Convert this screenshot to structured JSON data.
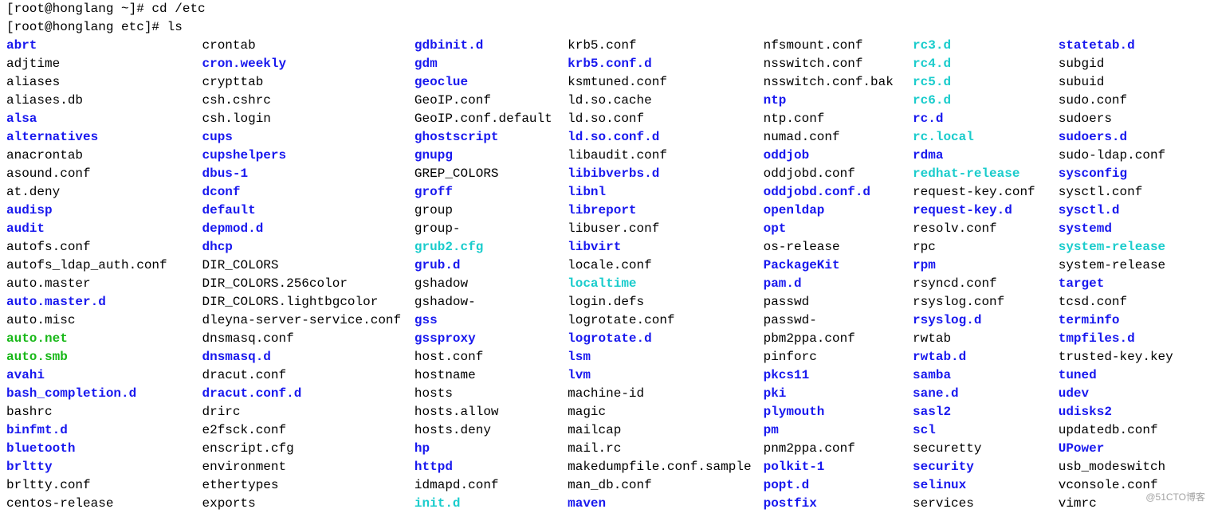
{
  "prompt1": "[root@honglang ~]# cd /etc",
  "prompt2": "[root@honglang etc]# ls",
  "watermark": "@51CTO博客",
  "columns": [
    [
      {
        "name": "abrt",
        "type": "dir"
      },
      {
        "name": "adjtime",
        "type": "file"
      },
      {
        "name": "aliases",
        "type": "file"
      },
      {
        "name": "aliases.db",
        "type": "file"
      },
      {
        "name": "alsa",
        "type": "dir"
      },
      {
        "name": "alternatives",
        "type": "dir"
      },
      {
        "name": "anacrontab",
        "type": "file"
      },
      {
        "name": "asound.conf",
        "type": "file"
      },
      {
        "name": "at.deny",
        "type": "file"
      },
      {
        "name": "audisp",
        "type": "dir"
      },
      {
        "name": "audit",
        "type": "dir"
      },
      {
        "name": "autofs.conf",
        "type": "file"
      },
      {
        "name": "autofs_ldap_auth.conf",
        "type": "file"
      },
      {
        "name": "auto.master",
        "type": "file"
      },
      {
        "name": "auto.master.d",
        "type": "dir"
      },
      {
        "name": "auto.misc",
        "type": "file"
      },
      {
        "name": "auto.net",
        "type": "exec"
      },
      {
        "name": "auto.smb",
        "type": "exec"
      },
      {
        "name": "avahi",
        "type": "dir"
      },
      {
        "name": "bash_completion.d",
        "type": "dir"
      },
      {
        "name": "bashrc",
        "type": "file"
      },
      {
        "name": "binfmt.d",
        "type": "dir"
      },
      {
        "name": "bluetooth",
        "type": "dir"
      },
      {
        "name": "brltty",
        "type": "dir"
      },
      {
        "name": "brltty.conf",
        "type": "file"
      },
      {
        "name": "centos-release",
        "type": "file"
      }
    ],
    [
      {
        "name": "crontab",
        "type": "file"
      },
      {
        "name": "cron.weekly",
        "type": "dir"
      },
      {
        "name": "crypttab",
        "type": "file"
      },
      {
        "name": "csh.cshrc",
        "type": "file"
      },
      {
        "name": "csh.login",
        "type": "file"
      },
      {
        "name": "cups",
        "type": "dir"
      },
      {
        "name": "cupshelpers",
        "type": "dir"
      },
      {
        "name": "dbus-1",
        "type": "dir"
      },
      {
        "name": "dconf",
        "type": "dir"
      },
      {
        "name": "default",
        "type": "dir"
      },
      {
        "name": "depmod.d",
        "type": "dir"
      },
      {
        "name": "dhcp",
        "type": "dir"
      },
      {
        "name": "DIR_COLORS",
        "type": "file"
      },
      {
        "name": "DIR_COLORS.256color",
        "type": "file"
      },
      {
        "name": "DIR_COLORS.lightbgcolor",
        "type": "file"
      },
      {
        "name": "dleyna-server-service.conf",
        "type": "file"
      },
      {
        "name": "dnsmasq.conf",
        "type": "file"
      },
      {
        "name": "dnsmasq.d",
        "type": "dir"
      },
      {
        "name": "dracut.conf",
        "type": "file"
      },
      {
        "name": "dracut.conf.d",
        "type": "dir"
      },
      {
        "name": "drirc",
        "type": "file"
      },
      {
        "name": "e2fsck.conf",
        "type": "file"
      },
      {
        "name": "enscript.cfg",
        "type": "file"
      },
      {
        "name": "environment",
        "type": "file"
      },
      {
        "name": "ethertypes",
        "type": "file"
      },
      {
        "name": "exports",
        "type": "file"
      }
    ],
    [
      {
        "name": "gdbinit.d",
        "type": "dir"
      },
      {
        "name": "gdm",
        "type": "dir"
      },
      {
        "name": "geoclue",
        "type": "dir"
      },
      {
        "name": "GeoIP.conf",
        "type": "file"
      },
      {
        "name": "GeoIP.conf.default",
        "type": "file"
      },
      {
        "name": "ghostscript",
        "type": "dir"
      },
      {
        "name": "gnupg",
        "type": "dir"
      },
      {
        "name": "GREP_COLORS",
        "type": "file"
      },
      {
        "name": "groff",
        "type": "dir"
      },
      {
        "name": "group",
        "type": "file"
      },
      {
        "name": "group-",
        "type": "file"
      },
      {
        "name": "grub2.cfg",
        "type": "link"
      },
      {
        "name": "grub.d",
        "type": "dir"
      },
      {
        "name": "gshadow",
        "type": "file"
      },
      {
        "name": "gshadow-",
        "type": "file"
      },
      {
        "name": "gss",
        "type": "dir"
      },
      {
        "name": "gssproxy",
        "type": "dir"
      },
      {
        "name": "host.conf",
        "type": "file"
      },
      {
        "name": "hostname",
        "type": "file"
      },
      {
        "name": "hosts",
        "type": "file"
      },
      {
        "name": "hosts.allow",
        "type": "file"
      },
      {
        "name": "hosts.deny",
        "type": "file"
      },
      {
        "name": "hp",
        "type": "dir"
      },
      {
        "name": "httpd",
        "type": "dir"
      },
      {
        "name": "idmapd.conf",
        "type": "file"
      },
      {
        "name": "init.d",
        "type": "link"
      }
    ],
    [
      {
        "name": "krb5.conf",
        "type": "file"
      },
      {
        "name": "krb5.conf.d",
        "type": "dir"
      },
      {
        "name": "ksmtuned.conf",
        "type": "file"
      },
      {
        "name": "ld.so.cache",
        "type": "file"
      },
      {
        "name": "ld.so.conf",
        "type": "file"
      },
      {
        "name": "ld.so.conf.d",
        "type": "dir"
      },
      {
        "name": "libaudit.conf",
        "type": "file"
      },
      {
        "name": "libibverbs.d",
        "type": "dir"
      },
      {
        "name": "libnl",
        "type": "dir"
      },
      {
        "name": "libreport",
        "type": "dir"
      },
      {
        "name": "libuser.conf",
        "type": "file"
      },
      {
        "name": "libvirt",
        "type": "dir"
      },
      {
        "name": "locale.conf",
        "type": "file"
      },
      {
        "name": "localtime",
        "type": "link"
      },
      {
        "name": "login.defs",
        "type": "file"
      },
      {
        "name": "logrotate.conf",
        "type": "file"
      },
      {
        "name": "logrotate.d",
        "type": "dir"
      },
      {
        "name": "lsm",
        "type": "dir"
      },
      {
        "name": "lvm",
        "type": "dir"
      },
      {
        "name": "machine-id",
        "type": "file"
      },
      {
        "name": "magic",
        "type": "file"
      },
      {
        "name": "mailcap",
        "type": "file"
      },
      {
        "name": "mail.rc",
        "type": "file"
      },
      {
        "name": "makedumpfile.conf.sample",
        "type": "file"
      },
      {
        "name": "man_db.conf",
        "type": "file"
      },
      {
        "name": "maven",
        "type": "dir"
      }
    ],
    [
      {
        "name": "nfsmount.conf",
        "type": "file"
      },
      {
        "name": "nsswitch.conf",
        "type": "file"
      },
      {
        "name": "nsswitch.conf.bak",
        "type": "file"
      },
      {
        "name": "ntp",
        "type": "dir"
      },
      {
        "name": "ntp.conf",
        "type": "file"
      },
      {
        "name": "numad.conf",
        "type": "file"
      },
      {
        "name": "oddjob",
        "type": "dir"
      },
      {
        "name": "oddjobd.conf",
        "type": "file"
      },
      {
        "name": "oddjobd.conf.d",
        "type": "dir"
      },
      {
        "name": "openldap",
        "type": "dir"
      },
      {
        "name": "opt",
        "type": "dir"
      },
      {
        "name": "os-release",
        "type": "file"
      },
      {
        "name": "PackageKit",
        "type": "dir"
      },
      {
        "name": "pam.d",
        "type": "dir"
      },
      {
        "name": "passwd",
        "type": "file"
      },
      {
        "name": "passwd-",
        "type": "file"
      },
      {
        "name": "pbm2ppa.conf",
        "type": "file"
      },
      {
        "name": "pinforc",
        "type": "file"
      },
      {
        "name": "pkcs11",
        "type": "dir"
      },
      {
        "name": "pki",
        "type": "dir"
      },
      {
        "name": "plymouth",
        "type": "dir"
      },
      {
        "name": "pm",
        "type": "dir"
      },
      {
        "name": "pnm2ppa.conf",
        "type": "file"
      },
      {
        "name": "polkit-1",
        "type": "dir"
      },
      {
        "name": "popt.d",
        "type": "dir"
      },
      {
        "name": "postfix",
        "type": "dir"
      }
    ],
    [
      {
        "name": "rc3.d",
        "type": "link"
      },
      {
        "name": "rc4.d",
        "type": "link"
      },
      {
        "name": "rc5.d",
        "type": "link"
      },
      {
        "name": "rc6.d",
        "type": "link"
      },
      {
        "name": "rc.d",
        "type": "dir"
      },
      {
        "name": "rc.local",
        "type": "link"
      },
      {
        "name": "rdma",
        "type": "dir"
      },
      {
        "name": "redhat-release",
        "type": "link"
      },
      {
        "name": "request-key.conf",
        "type": "file"
      },
      {
        "name": "request-key.d",
        "type": "dir"
      },
      {
        "name": "resolv.conf",
        "type": "file"
      },
      {
        "name": "rpc",
        "type": "file"
      },
      {
        "name": "rpm",
        "type": "dir"
      },
      {
        "name": "rsyncd.conf",
        "type": "file"
      },
      {
        "name": "rsyslog.conf",
        "type": "file"
      },
      {
        "name": "rsyslog.d",
        "type": "dir"
      },
      {
        "name": "rwtab",
        "type": "file"
      },
      {
        "name": "rwtab.d",
        "type": "dir"
      },
      {
        "name": "samba",
        "type": "dir"
      },
      {
        "name": "sane.d",
        "type": "dir"
      },
      {
        "name": "sasl2",
        "type": "dir"
      },
      {
        "name": "scl",
        "type": "dir"
      },
      {
        "name": "securetty",
        "type": "file"
      },
      {
        "name": "security",
        "type": "dir"
      },
      {
        "name": "selinux",
        "type": "dir"
      },
      {
        "name": "services",
        "type": "file"
      }
    ],
    [
      {
        "name": "statetab.d",
        "type": "dir"
      },
      {
        "name": "subgid",
        "type": "file"
      },
      {
        "name": "subuid",
        "type": "file"
      },
      {
        "name": "sudo.conf",
        "type": "file"
      },
      {
        "name": "sudoers",
        "type": "file"
      },
      {
        "name": "sudoers.d",
        "type": "dir"
      },
      {
        "name": "sudo-ldap.conf",
        "type": "file"
      },
      {
        "name": "sysconfig",
        "type": "dir"
      },
      {
        "name": "sysctl.conf",
        "type": "file"
      },
      {
        "name": "sysctl.d",
        "type": "dir"
      },
      {
        "name": "systemd",
        "type": "dir"
      },
      {
        "name": "system-release",
        "type": "link"
      },
      {
        "name": "system-release",
        "type": "file"
      },
      {
        "name": "target",
        "type": "dir"
      },
      {
        "name": "tcsd.conf",
        "type": "file"
      },
      {
        "name": "terminfo",
        "type": "dir"
      },
      {
        "name": "tmpfiles.d",
        "type": "dir"
      },
      {
        "name": "trusted-key.key",
        "type": "file"
      },
      {
        "name": "tuned",
        "type": "dir"
      },
      {
        "name": "udev",
        "type": "dir"
      },
      {
        "name": "udisks2",
        "type": "dir"
      },
      {
        "name": "updatedb.conf",
        "type": "file"
      },
      {
        "name": "UPower",
        "type": "dir"
      },
      {
        "name": "usb_modeswitch",
        "type": "file"
      },
      {
        "name": "vconsole.conf",
        "type": "file"
      },
      {
        "name": "vimrc",
        "type": "file"
      }
    ]
  ]
}
